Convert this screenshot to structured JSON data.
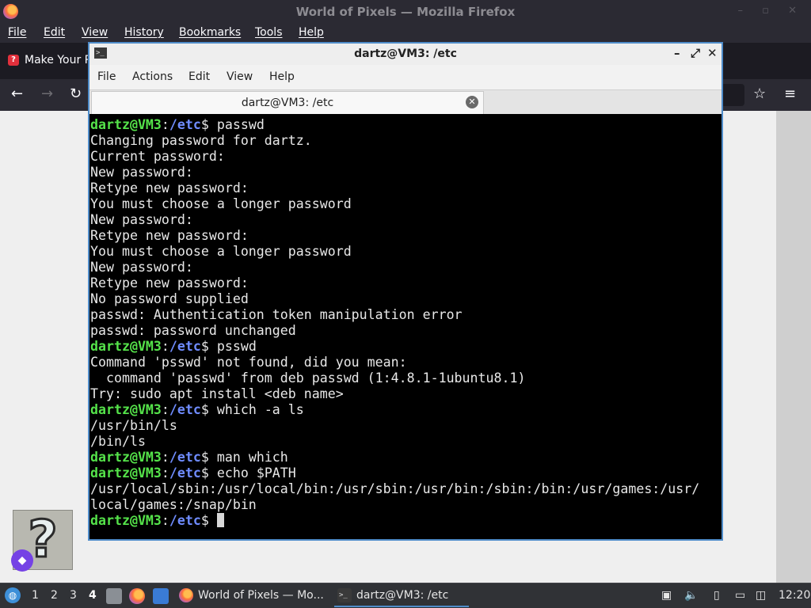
{
  "firefox": {
    "window_title": "World of Pixels — Mozilla Firefox",
    "menu": [
      "File",
      "Edit",
      "View",
      "History",
      "Bookmarks",
      "Tools",
      "Help"
    ],
    "tab_label": "Make Your P",
    "nav_icons": [
      "back-icon",
      "forward-icon",
      "reload-icon",
      "bookmark-star-icon",
      "hamburger-menu-icon"
    ]
  },
  "terminal": {
    "title": "dartz@VM3: /etc",
    "menu": [
      "File",
      "Actions",
      "Edit",
      "View",
      "Help"
    ],
    "tab_label": "dartz@VM3: /etc",
    "prompt_user": "dartz@VM3",
    "prompt_path": "/etc",
    "lines": [
      {
        "type": "prompt",
        "cmd": "passwd"
      },
      {
        "type": "out",
        "text": "Changing password for dartz."
      },
      {
        "type": "out",
        "text": "Current password:"
      },
      {
        "type": "out",
        "text": "New password:"
      },
      {
        "type": "out",
        "text": "Retype new password:"
      },
      {
        "type": "out",
        "text": "You must choose a longer password"
      },
      {
        "type": "out",
        "text": "New password:"
      },
      {
        "type": "out",
        "text": "Retype new password:"
      },
      {
        "type": "out",
        "text": "You must choose a longer password"
      },
      {
        "type": "out",
        "text": "New password:"
      },
      {
        "type": "out",
        "text": "Retype new password:"
      },
      {
        "type": "out",
        "text": "No password supplied"
      },
      {
        "type": "out",
        "text": "passwd: Authentication token manipulation error"
      },
      {
        "type": "out",
        "text": "passwd: password unchanged"
      },
      {
        "type": "prompt",
        "cmd": "psswd"
      },
      {
        "type": "out",
        "text": "Command 'psswd' not found, did you mean:"
      },
      {
        "type": "out",
        "text": "  command 'passwd' from deb passwd (1:4.8.1-1ubuntu8.1)"
      },
      {
        "type": "out",
        "text": "Try: sudo apt install <deb name>"
      },
      {
        "type": "prompt",
        "cmd": "which -a ls"
      },
      {
        "type": "out",
        "text": "/usr/bin/ls"
      },
      {
        "type": "out",
        "text": "/bin/ls"
      },
      {
        "type": "prompt",
        "cmd": "man which"
      },
      {
        "type": "prompt",
        "cmd": "echo $PATH"
      },
      {
        "type": "out",
        "text": "/usr/local/sbin:/usr/local/bin:/usr/sbin:/usr/bin:/sbin:/bin:/usr/games:/usr/"
      },
      {
        "type": "out",
        "text": "local/games:/snap/bin"
      },
      {
        "type": "prompt",
        "cmd": "",
        "cursor": true
      }
    ]
  },
  "taskbar": {
    "workspaces": [
      "1",
      "2",
      "3",
      "4"
    ],
    "active_workspace": "4",
    "tasks": [
      {
        "label": "World of Pixels — Mo...",
        "icon": "firefox-icon"
      },
      {
        "label": "dartz@VM3: /etc",
        "icon": "terminal-icon"
      }
    ],
    "clock": "12:20"
  }
}
